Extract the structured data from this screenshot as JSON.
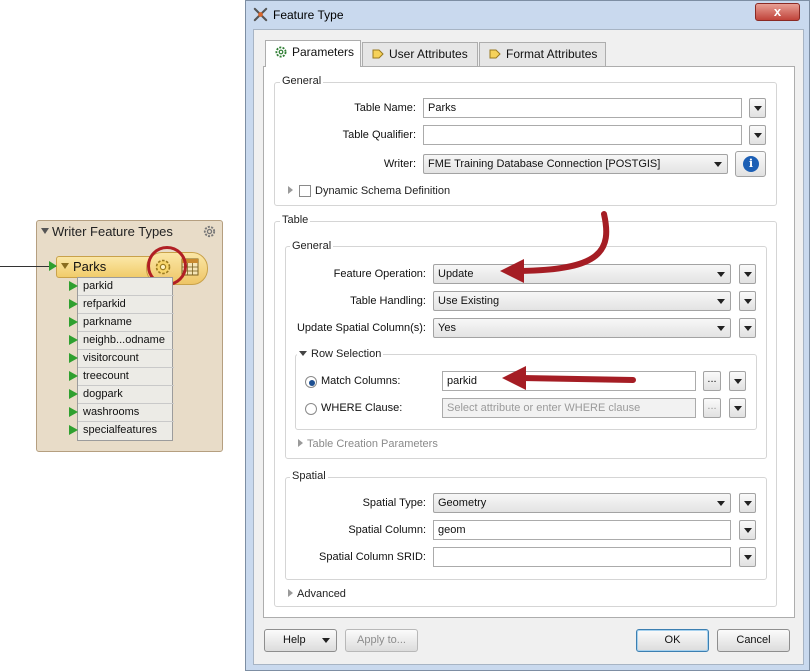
{
  "canvas": {
    "writer_feature_types": {
      "title": "Writer Feature Types",
      "feature_type": "Parks",
      "attributes": [
        "parkid",
        "refparkid",
        "parkname",
        "neighb...odname",
        "visitorcount",
        "treecount",
        "dogpark",
        "washrooms",
        "specialfeatures"
      ]
    }
  },
  "dialog": {
    "title": "Feature Type",
    "close_label": "x",
    "tabs": [
      {
        "label": "Parameters"
      },
      {
        "label": "User Attributes"
      },
      {
        "label": "Format Attributes"
      }
    ],
    "general": {
      "group_label": "General",
      "table_name_label": "Table Name:",
      "table_name_value": "Parks",
      "table_qualifier_label": "Table Qualifier:",
      "table_qualifier_value": "",
      "writer_label": "Writer:",
      "writer_value": "FME Training Database Connection [POSTGIS]",
      "info_label": "i",
      "dynamic_schema_label": "Dynamic Schema Definition"
    },
    "table": {
      "group_label": "Table",
      "general_label": "General",
      "feature_operation_label": "Feature Operation:",
      "feature_operation_value": "Update",
      "table_handling_label": "Table Handling:",
      "table_handling_value": "Use Existing",
      "update_spatial_label": "Update Spatial Column(s):",
      "update_spatial_value": "Yes",
      "row_selection_label": "Row Selection",
      "match_columns_label": "Match Columns:",
      "match_columns_value": "parkid",
      "where_clause_label": "WHERE Clause:",
      "where_clause_placeholder": "Select attribute or enter WHERE clause",
      "dots_label": "...",
      "table_creation_label": "Table Creation Parameters"
    },
    "spatial": {
      "group_label": "Spatial",
      "spatial_type_label": "Spatial Type:",
      "spatial_type_value": "Geometry",
      "spatial_column_label": "Spatial Column:",
      "spatial_column_value": "geom",
      "spatial_srid_label": "Spatial Column SRID:",
      "spatial_srid_value": ""
    },
    "advanced_label": "Advanced",
    "buttons": {
      "help": "Help",
      "apply": "Apply to...",
      "ok": "OK",
      "cancel": "Cancel"
    }
  },
  "colors": {
    "annotation_red": "#a51d24",
    "feature_type_yellow": "#f1cc6a",
    "port_green": "#2fa02f"
  }
}
